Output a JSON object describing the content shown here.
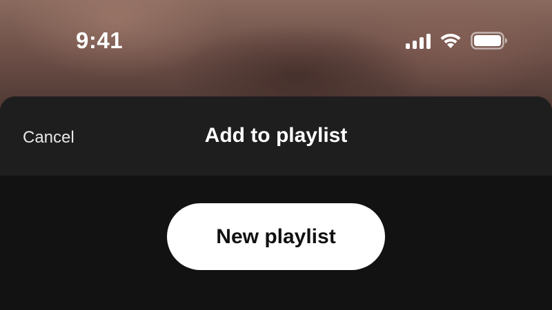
{
  "status_bar": {
    "time": "9:41",
    "icons": [
      "signal-icon",
      "wifi-icon",
      "battery-icon"
    ]
  },
  "sheet": {
    "title": "Add to playlist",
    "cancel_label": "Cancel",
    "new_playlist_label": "New playlist"
  },
  "colors": {
    "sheet_background": "#121212",
    "header_background": "#1e1e1e",
    "button_background": "#ffffff",
    "button_text": "#111111"
  }
}
